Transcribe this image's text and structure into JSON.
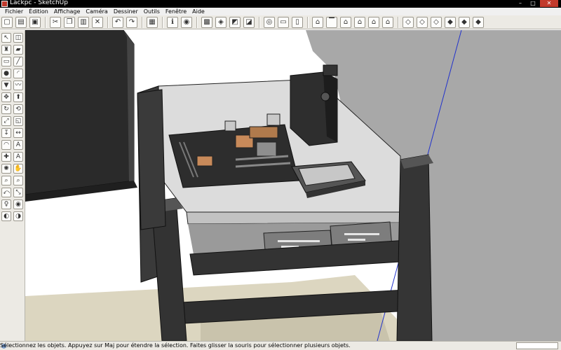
{
  "window": {
    "title": "Lackpc - SketchUp",
    "buttons": {
      "minimize": "–",
      "maximize": "□",
      "close": "✕"
    }
  },
  "menu": {
    "items": [
      {
        "label": "Fichier"
      },
      {
        "label": "Édition"
      },
      {
        "label": "Affichage"
      },
      {
        "label": "Caméra"
      },
      {
        "label": "Dessiner"
      },
      {
        "label": "Outils"
      },
      {
        "label": "Fenêtre"
      },
      {
        "label": "Aide"
      }
    ]
  },
  "toolbar": {
    "buttons": [
      {
        "name": "new-icon",
        "glyph": "▢"
      },
      {
        "name": "open-icon",
        "glyph": "▤"
      },
      {
        "name": "save-icon",
        "glyph": "▣"
      },
      {
        "name": "cut-icon",
        "glyph": "✂"
      },
      {
        "name": "copy-icon",
        "glyph": "❐"
      },
      {
        "name": "paste-icon",
        "glyph": "▥"
      },
      {
        "name": "erase-icon",
        "glyph": "✕"
      },
      {
        "name": "undo-icon",
        "glyph": "↶"
      },
      {
        "name": "redo-icon",
        "glyph": "↷"
      },
      {
        "name": "print-icon",
        "glyph": "▦"
      },
      {
        "name": "model-info-icon",
        "glyph": "ℹ"
      },
      {
        "name": "google-earth-icon",
        "glyph": "◉"
      },
      {
        "name": "toggle-terrain-icon",
        "glyph": "▩"
      },
      {
        "name": "place-model-icon",
        "glyph": "◈"
      },
      {
        "name": "get-models-icon",
        "glyph": "◩"
      },
      {
        "name": "share-model-icon",
        "glyph": "◪"
      },
      {
        "name": "component-icon",
        "glyph": "◎"
      },
      {
        "name": "x-ray-icon",
        "glyph": "▭"
      },
      {
        "name": "back-edges-icon",
        "glyph": "▯"
      },
      {
        "name": "iso-view-icon",
        "glyph": "⌂"
      },
      {
        "name": "top-view-icon",
        "glyph": "▔"
      },
      {
        "name": "front-view-icon",
        "glyph": "⌂"
      },
      {
        "name": "right-view-icon",
        "glyph": "⌂"
      },
      {
        "name": "back-view-icon",
        "glyph": "⌂"
      },
      {
        "name": "left-view-icon",
        "glyph": "⌂"
      },
      {
        "name": "xray-style-icon",
        "glyph": "◇"
      },
      {
        "name": "wireframe-icon",
        "glyph": "◇"
      },
      {
        "name": "hidden-line-icon",
        "glyph": "◇"
      },
      {
        "name": "shaded-icon",
        "glyph": "◆"
      },
      {
        "name": "shaded-textures-icon",
        "glyph": "◆"
      },
      {
        "name": "monochrome-icon",
        "glyph": "◆"
      }
    ],
    "separators_after": [
      2,
      6,
      8,
      9,
      11,
      15,
      18,
      24
    ]
  },
  "palette": {
    "tools": [
      {
        "name": "select-tool-icon",
        "glyph": "↖"
      },
      {
        "name": "make-component-icon",
        "glyph": "◫"
      },
      {
        "name": "paint-bucket-icon",
        "glyph": "♜"
      },
      {
        "name": "eraser-icon",
        "glyph": "▰"
      },
      {
        "name": "rectangle-tool-icon",
        "glyph": "▭"
      },
      {
        "name": "line-tool-icon",
        "glyph": "╱"
      },
      {
        "name": "circle-tool-icon",
        "glyph": "●"
      },
      {
        "name": "arc-tool-icon",
        "glyph": "◜"
      },
      {
        "name": "polygon-tool-icon",
        "glyph": "▼"
      },
      {
        "name": "freehand-tool-icon",
        "glyph": "〰"
      },
      {
        "name": "move-tool-icon",
        "glyph": "✥"
      },
      {
        "name": "push-pull-tool-icon",
        "glyph": "⬆"
      },
      {
        "name": "rotate-tool-icon",
        "glyph": "↻"
      },
      {
        "name": "follow-me-tool-icon",
        "glyph": "⟲"
      },
      {
        "name": "scale-tool-icon",
        "glyph": "⤢"
      },
      {
        "name": "offset-tool-icon",
        "glyph": "◱"
      },
      {
        "name": "tape-measure-icon",
        "glyph": "↧"
      },
      {
        "name": "dimension-tool-icon",
        "glyph": "↔"
      },
      {
        "name": "protractor-tool-icon",
        "glyph": "◠"
      },
      {
        "name": "text-tool-icon",
        "glyph": "A"
      },
      {
        "name": "axes-tool-icon",
        "glyph": "✚"
      },
      {
        "name": "3d-text-tool-icon",
        "glyph": "A"
      },
      {
        "name": "orbit-tool-icon",
        "glyph": "✺"
      },
      {
        "name": "pan-tool-icon",
        "glyph": "✋"
      },
      {
        "name": "zoom-tool-icon",
        "glyph": "⌕"
      },
      {
        "name": "zoom-window-icon",
        "glyph": "⌕"
      },
      {
        "name": "previous-view-icon",
        "glyph": "⤺"
      },
      {
        "name": "zoom-extents-icon",
        "glyph": "⤡"
      },
      {
        "name": "position-camera-icon",
        "glyph": "♀"
      },
      {
        "name": "look-around-icon",
        "glyph": "◉"
      },
      {
        "name": "walk-tool-icon",
        "glyph": "◐"
      },
      {
        "name": "section-plane-icon",
        "glyph": "◑"
      }
    ]
  },
  "status": {
    "text": "Sélectionnez les objets. Appuyez sur Maj pour étendre la sélection. Faites glisser la souris pour sélectionner plusieurs objets."
  }
}
